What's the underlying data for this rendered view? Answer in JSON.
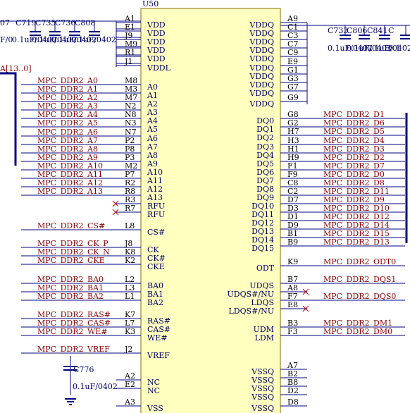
{
  "component": {
    "designator": "U50",
    "body_color": "#ffffc0"
  },
  "colors": {
    "wire": "#000080",
    "net_label": "#8b0000",
    "pin_number": "#000000",
    "pin_name": "#000066",
    "no_connect": "#cc0000"
  },
  "bus_label": "A[13..0]",
  "top_left_caps": [
    {
      "ref": "C719",
      "value": "0.1uF/0402"
    },
    {
      "ref": "C735",
      "value": "0.1uF/0402"
    },
    {
      "ref": "C736",
      "value": "0.1uF/0402"
    },
    {
      "ref": "C808",
      "value": "0.1uF/0402"
    }
  ],
  "top_left_partial_ref": "07",
  "top_left_value_prefix": "F/0",
  "top_right_caps": [
    {
      "ref": "C733",
      "value": "0.1uF/0402"
    },
    {
      "ref": "C806",
      "value": "0.1uF/0402"
    },
    {
      "ref": "C841",
      "value": "0.1uF/0402"
    },
    {
      "ref": "C",
      "value": "0.1"
    }
  ],
  "bottom_cap": {
    "ref": "C776",
    "value": "0.1uF/0402"
  },
  "left_pins": [
    {
      "num": "A1",
      "name": "VDD",
      "net": ""
    },
    {
      "num": "E1",
      "name": "VDD",
      "net": ""
    },
    {
      "num": "J9",
      "name": "VDD",
      "net": ""
    },
    {
      "num": "M9",
      "name": "VDD",
      "net": ""
    },
    {
      "num": "R1",
      "name": "VDD",
      "net": ""
    },
    {
      "num": "J1",
      "name": "VDDL",
      "net": ""
    },
    {
      "num": "M8",
      "name": "A0",
      "net": "MPC_DDR2_A0"
    },
    {
      "num": "M3",
      "name": "A1",
      "net": "MPC_DDR2_A1"
    },
    {
      "num": "M7",
      "name": "A2",
      "net": "MPC_DDR2_A2"
    },
    {
      "num": "N2",
      "name": "A3",
      "net": "MPC_DDR2_A3"
    },
    {
      "num": "N8",
      "name": "A4",
      "net": "MPC_DDR2_A4"
    },
    {
      "num": "N3",
      "name": "A5",
      "net": "MPC_DDR2_A5"
    },
    {
      "num": "N7",
      "name": "A6",
      "net": "MPC_DDR2_A6"
    },
    {
      "num": "P2",
      "name": "A7",
      "net": "MPC_DDR2_A7"
    },
    {
      "num": "P8",
      "name": "A8",
      "net": "MPC_DDR2_A8"
    },
    {
      "num": "P3",
      "name": "A9",
      "net": "MPC_DDR2_A9"
    },
    {
      "num": "M2",
      "name": "A10",
      "net": "MPC_DDR2_A10"
    },
    {
      "num": "P7",
      "name": "A11",
      "net": "MPC_DDR2_A11"
    },
    {
      "num": "R2",
      "name": "A12",
      "net": "MPC_DDR2_A12"
    },
    {
      "num": "R8",
      "name": "A13",
      "net": "MPC_DDR2_A13"
    },
    {
      "num": "R3",
      "name": "RFU",
      "net": ""
    },
    {
      "num": "R7",
      "name": "RFU",
      "net": ""
    },
    {
      "num": "L8",
      "name": "CS#",
      "net": "MPC_DDR2_CS#"
    },
    {
      "num": "J8",
      "name": "CK",
      "net": "MPC_DDR2_CK_P"
    },
    {
      "num": "K8",
      "name": "CK#",
      "net": "MPC_DDR2_CK_N"
    },
    {
      "num": "K2",
      "name": "CKE",
      "net": "MPC_DDR2_CKE"
    },
    {
      "num": "L2",
      "name": "BA0",
      "net": "MPC_DDR2_BA0"
    },
    {
      "num": "L3",
      "name": "BA1",
      "net": "MPC_DDR2_BA1"
    },
    {
      "num": "L1",
      "name": "BA2",
      "net": "MPC_DDR2_BA2"
    },
    {
      "num": "K7",
      "name": "RAS#",
      "net": "MPC_DDR2_RAS#"
    },
    {
      "num": "L7",
      "name": "CAS#",
      "net": "MPC_DDR2_CAS#"
    },
    {
      "num": "K3",
      "name": "WE#",
      "net": "MPC_DDR2_WE#"
    },
    {
      "num": "J2",
      "name": "VREF",
      "net": "MPC_DDR2_VREF"
    },
    {
      "num": "A2",
      "name": "NC",
      "net": ""
    },
    {
      "num": "E2",
      "name": "NC",
      "net": ""
    },
    {
      "num": "A3",
      "name": "VSS",
      "net": ""
    }
  ],
  "right_pins": [
    {
      "num": "A9",
      "name": "VDDQ",
      "net": ""
    },
    {
      "num": "C1",
      "name": "VDDQ",
      "net": ""
    },
    {
      "num": "C3",
      "name": "VDDQ",
      "net": ""
    },
    {
      "num": "C7",
      "name": "VDDQ",
      "net": ""
    },
    {
      "num": "C9",
      "name": "VDDQ",
      "net": ""
    },
    {
      "num": "E9",
      "name": "VDDQ",
      "net": ""
    },
    {
      "num": "G1",
      "name": "VDDQ",
      "net": ""
    },
    {
      "num": "G3",
      "name": "VDDQ",
      "net": ""
    },
    {
      "num": "G7",
      "name": "VDDQ",
      "net": ""
    },
    {
      "num": "G9",
      "name": "VDDQ",
      "net": ""
    },
    {
      "num": "G8",
      "name": "DQ0",
      "net": "MPC_DDR2_D1"
    },
    {
      "num": "G2",
      "name": "DQ1",
      "net": "MPC_DDR2_D6"
    },
    {
      "num": "H7",
      "name": "DQ2",
      "net": "MPC_DDR2_D5"
    },
    {
      "num": "H3",
      "name": "DQ3",
      "net": "MPC_DDR2_D4"
    },
    {
      "num": "H1",
      "name": "DQ4",
      "net": "MPC_DDR2_D3"
    },
    {
      "num": "H9",
      "name": "DQ5",
      "net": "MPC_DDR2_D2"
    },
    {
      "num": "F1",
      "name": "DQ6",
      "net": "MPC_DDR2_D7"
    },
    {
      "num": "F9",
      "name": "DQ7",
      "net": "MPC_DDR2_D0"
    },
    {
      "num": "C8",
      "name": "DQ8",
      "net": "MPC_DDR2_D8"
    },
    {
      "num": "C2",
      "name": "DQ9",
      "net": "MPC_DDR2_D11"
    },
    {
      "num": "D7",
      "name": "DQ10",
      "net": "MPC_DDR2_D9"
    },
    {
      "num": "D3",
      "name": "DQ11",
      "net": "MPC_DDR2_D10"
    },
    {
      "num": "D1",
      "name": "DQ12",
      "net": "MPC_DDR2_D12"
    },
    {
      "num": "D9",
      "name": "DQ13",
      "net": "MPC_DDR2_D14"
    },
    {
      "num": "B1",
      "name": "DQ14",
      "net": "MPC_DDR2_D15"
    },
    {
      "num": "B9",
      "name": "DQ15",
      "net": "MPC_DDR2_D13"
    },
    {
      "num": "K9",
      "name": "ODT",
      "net": "MPC_DDR2_ODT0"
    },
    {
      "num": "B7",
      "name": "UDQS",
      "net": "MPC_DDR2_DQS1"
    },
    {
      "num": "A8",
      "name": "UDQS#/NU",
      "net": ""
    },
    {
      "num": "F7",
      "name": "LDQS",
      "net": "MPC_DDR2_DQS0"
    },
    {
      "num": "E8",
      "name": "LDQS#/NU",
      "net": ""
    },
    {
      "num": "B3",
      "name": "UDM",
      "net": "MPC_DDR2_DM1"
    },
    {
      "num": "F3",
      "name": "LDM",
      "net": "MPC_DDR2_DM0"
    },
    {
      "num": "A7",
      "name": "VSSQ",
      "net": ""
    },
    {
      "num": "B2",
      "name": "VSSQ",
      "net": ""
    },
    {
      "num": "B8",
      "name": "VSSQ",
      "net": ""
    },
    {
      "num": "D2",
      "name": "VSSQ",
      "net": ""
    },
    {
      "num": "D8",
      "name": "VSSQ",
      "net": ""
    }
  ]
}
